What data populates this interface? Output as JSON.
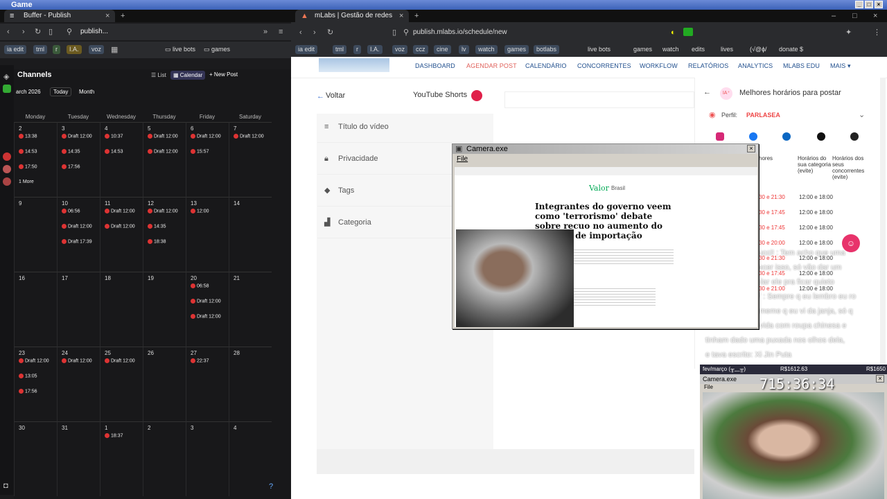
{
  "desktop": {
    "title": "Game"
  },
  "left": {
    "tab": "Buffer - Publish",
    "url": "publish...",
    "bookmarks": [
      "ia edit",
      "tml",
      "r",
      "I.A.",
      "voz",
      "live bots",
      "games"
    ],
    "channels_label": "Channels",
    "view_list": "List",
    "view_calendar": "Calendar",
    "new_post": "New Post",
    "month": "arch 2026",
    "today": "Today",
    "range": "Month",
    "days": [
      "Monday",
      "Tuesday",
      "Wednesday",
      "Thursday",
      "Friday",
      "Saturday"
    ],
    "weeks": [
      [
        {
          "n": "2",
          "p": [
            "13:38",
            "14:53",
            "17:50"
          ],
          "more": "1 More"
        },
        {
          "n": "3",
          "p": [
            "Draft 12:00",
            "14:35",
            "17:56"
          ]
        },
        {
          "n": "4",
          "p": [
            "10:37",
            "14:53"
          ]
        },
        {
          "n": "5",
          "p": [
            "Draft 12:00",
            "Draft 12:00"
          ]
        },
        {
          "n": "6",
          "p": [
            "Draft 12:00",
            "15:57"
          ]
        },
        {
          "n": "7",
          "p": [
            "Draft 12:00"
          ]
        }
      ],
      [
        {
          "n": "9",
          "p": []
        },
        {
          "n": "10",
          "p": [
            "06:56",
            "Draft 12:00",
            "Draft 17:39"
          ]
        },
        {
          "n": "11",
          "p": [
            "Draft 12:00",
            "Draft 12:00"
          ]
        },
        {
          "n": "12",
          "p": [
            "Draft 12:00",
            "14:35",
            "18:38"
          ]
        },
        {
          "n": "13",
          "p": [
            "12:00"
          ]
        },
        {
          "n": "14",
          "p": []
        }
      ],
      [
        {
          "n": "16",
          "p": []
        },
        {
          "n": "17",
          "p": []
        },
        {
          "n": "18",
          "p": []
        },
        {
          "n": "19",
          "p": []
        },
        {
          "n": "20",
          "p": [
            "06:58",
            "Draft 12:00",
            "Draft 12:00"
          ]
        },
        {
          "n": "21",
          "p": []
        }
      ],
      [
        {
          "n": "23",
          "p": [
            "Draft 12:00",
            "13:05",
            "17:56"
          ]
        },
        {
          "n": "24",
          "p": [
            "Draft 12:00"
          ]
        },
        {
          "n": "25",
          "p": [
            "Draft 12:00"
          ]
        },
        {
          "n": "26",
          "p": []
        },
        {
          "n": "27",
          "p": [
            "22:37"
          ]
        },
        {
          "n": "28",
          "p": []
        }
      ],
      [
        {
          "n": "30",
          "p": []
        },
        {
          "n": "31",
          "p": []
        },
        {
          "n": "1",
          "p": [
            "18:37"
          ]
        },
        {
          "n": "2",
          "p": []
        },
        {
          "n": "3",
          "p": []
        },
        {
          "n": "4",
          "p": []
        }
      ]
    ]
  },
  "right": {
    "tab": "mLabs | Gestão de redes sociais",
    "url": "publish.mlabs.io/schedule/new",
    "bookmarks": [
      "ia edit",
      "tml",
      "r",
      "I.A.",
      "voz",
      "ccz",
      "cine",
      "lv",
      "watch",
      "games",
      "botlabs",
      "live bots",
      "games",
      "watch",
      "edits",
      "lives",
      "(√@ɸ/",
      "donate $"
    ],
    "nav": [
      "DASHBOARD",
      "AGENDAR POST",
      "CALENDÁRIO",
      "CONCORRENTES",
      "WORKFLOW",
      "RELATÓRIOS",
      "ANALYTICS",
      "MLABS EDU",
      "MAIS ▾"
    ],
    "back": "Voltar",
    "network": "YouTube Shorts",
    "fields": [
      "Título do vídeo",
      "Privacidade",
      "Tags",
      "Categoria"
    ],
    "panel_title": "Melhores horários para postar",
    "perfil_label": "Perfil:",
    "perfil": "PARLASEA",
    "cols": [
      "hores",
      "Horários do sua categoria (evite)",
      "Horários dos seus concorrentes (evite)"
    ],
    "hours": [
      [
        "30 e 21:30",
        "12:00 e 18:00"
      ],
      [
        "30 e 17:45",
        "12:00 e 18:00"
      ],
      [
        "30 e 17:45",
        "12:00 e 18:00"
      ],
      [
        "30 e 20:00",
        "12:00 e 18:00"
      ],
      [
        "30 e 21:30",
        "12:00 e 18:00"
      ],
      [
        "30 e 17:45",
        "12:00 e 18:00"
      ],
      [
        "30 e 21:00",
        "12:00 e 18:00"
      ]
    ]
  },
  "camera": {
    "title": "Camera.exe",
    "menu": "File",
    "headline": "Integrantes do governo veem como 'terrorismo' debate sobre recuo no aumento do imposto de importação",
    "brand": "Valor",
    "section": "Brasil"
  },
  "chat": [
    "lucci! : Tem acho que uma",
    "lecer isso, só vão dar um",
    "ular ele pra ficar quieto",
    "7 : Sempre q eu lembro eu ro",
    "meme q eu vi da janja, só q",
    "vida com roupa chinesa e",
    "tinham dado uma puxada nos olhos dela,",
    "e tava escrito: Xi Jin Puta"
  ],
  "webcam": {
    "label": "fev/março (╥﹏╥)",
    "amount": "R$1612.63",
    "amount2": "R$1650",
    "title": "Camera.exe",
    "menu": "File",
    "timer": "715:36:34"
  }
}
